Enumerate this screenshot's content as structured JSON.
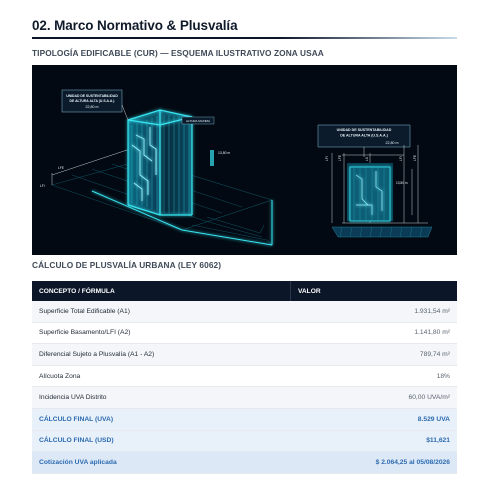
{
  "header": {
    "title": "02. Marco Normativo & Plusvalía",
    "subtitle": "TIPOLOGÍA EDIFICABLE (CUR) — ESQUEMA ILUSTRATIVO ZONA USAA"
  },
  "figure": {
    "left_label_1": "UNIDAD DE SUSTENTABILIDAD",
    "left_label_2": "DE ALTURA ALTA (U.S.A.A.)",
    "left_dim": "22,80 m",
    "tower_tag": "ALTURA MAXIMA",
    "tower_dim": "13,80 m",
    "right_label_1": "UNIDAD DE SUSTENTABILIDAD",
    "right_label_2": "DE ALTURA ALTA (U.S.A.A.)",
    "right_dim": "22,80 m",
    "right_side_dim": "13,80 m",
    "vert_1": "LFI",
    "vert_2": "LFE",
    "vert_3": "LS",
    "vert_4": "LFI",
    "vert_5": "LFE",
    "ground_1": "LFE",
    "ground_2": "LFI"
  },
  "calc": {
    "title": "CÁLCULO DE PLUSVALÍA URBANA (LEY 6062)",
    "headers": {
      "concept": "CONCEPTO / FÓRMULA",
      "value": "VALOR"
    },
    "rows": [
      {
        "label": "Superficie Total Edificable (A1)",
        "value": "1.931,54 m²"
      },
      {
        "label": "Superficie Basamento/LFI (A2)",
        "value": "1.141,80 m²"
      },
      {
        "label": "Diferencial Sujeto a Plusvalía (A1 - A2)",
        "value": "789,74 m²"
      },
      {
        "label": "Alícuota Zona",
        "value": "18%"
      },
      {
        "label": "Incidencia UVA Distrito",
        "value": "60,00 UVA/m²"
      },
      {
        "label": "CÁLCULO FINAL (UVA)",
        "value": "8.529 UVA"
      },
      {
        "label": "CÁLCULO FINAL (USD)",
        "value": "$11,621"
      },
      {
        "label": "Cotización UVA aplicada",
        "value": "$ 2.064,25 al 05/08/2026"
      }
    ]
  },
  "colors": {
    "accent_blue": "#2c6bb0",
    "header_dark": "#0b1628",
    "figure_bg": "#020912",
    "neon_cyan": "#37e6f2"
  }
}
